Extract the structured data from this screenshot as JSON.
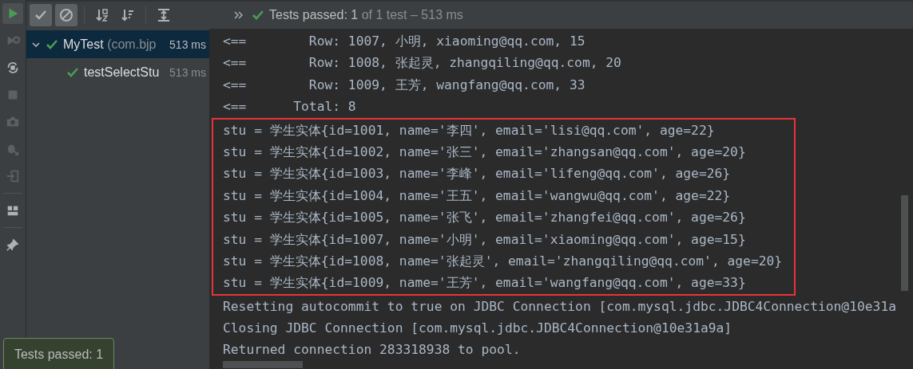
{
  "side_tools": [
    {
      "kind": "run",
      "disabled": false
    },
    {
      "kind": "rerun-failed",
      "disabled": true
    },
    {
      "kind": "auto-test",
      "disabled": false
    },
    {
      "kind": "stop",
      "disabled": true
    },
    {
      "kind": "camera",
      "disabled": true
    },
    {
      "kind": "export",
      "disabled": true
    },
    {
      "kind": "import",
      "disabled": true
    },
    {
      "kind": "layout",
      "disabled": false
    },
    {
      "kind": "pin",
      "disabled": false
    }
  ],
  "toolbar": {
    "buttons": [
      {
        "kind": "show-passed",
        "selected": true
      },
      {
        "kind": "show-ignored",
        "selected": true
      },
      {
        "kind": "sort-alpha",
        "selected": false
      },
      {
        "kind": "sort-duration",
        "selected": false
      },
      {
        "kind": "expand",
        "selected": false
      }
    ],
    "status": {
      "label": "Tests passed: 1",
      "detail": "of 1 test – 513 ms"
    }
  },
  "tree": [
    {
      "name": "MyTest",
      "package": "(com.bjp",
      "duration": "513 ms",
      "selected": true,
      "expanded": true,
      "children": [
        {
          "name": "testSelectStu",
          "duration": "513 ms",
          "selected": false
        }
      ]
    }
  ],
  "console": {
    "lines_before": [
      "<==        Row: 1007, 小明, xiaoming@qq.com, 15",
      "<==        Row: 1008, 张起灵, zhangqiling@qq.com, 20",
      "<==        Row: 1009, 王芳, wangfang@qq.com, 33",
      "<==      Total: 8"
    ],
    "highlighted_lines": [
      "stu = 学生实体{id=1001, name='李四', email='lisi@qq.com', age=22}",
      "stu = 学生实体{id=1002, name='张三', email='zhangsan@qq.com', age=20}",
      "stu = 学生实体{id=1003, name='李峰', email='lifeng@qq.com', age=26}",
      "stu = 学生实体{id=1004, name='王五', email='wangwu@qq.com', age=22}",
      "stu = 学生实体{id=1005, name='张飞', email='zhangfei@qq.com', age=26}",
      "stu = 学生实体{id=1007, name='小明', email='xiaoming@qq.com', age=15}",
      "stu = 学生实体{id=1008, name='张起灵', email='zhangqiling@qq.com', age=20}",
      "stu = 学生实体{id=1009, name='王芳', email='wangfang@qq.com', age=33}"
    ],
    "lines_after": [
      "Resetting autocommit to true on JDBC Connection [com.mysql.jdbc.JDBC4Connection@10e31a",
      "Closing JDBC Connection [com.mysql.jdbc.JDBC4Connection@10e31a9a]",
      "Returned connection 283318938 to pool."
    ]
  },
  "toast": {
    "text": "Tests passed: 1"
  }
}
